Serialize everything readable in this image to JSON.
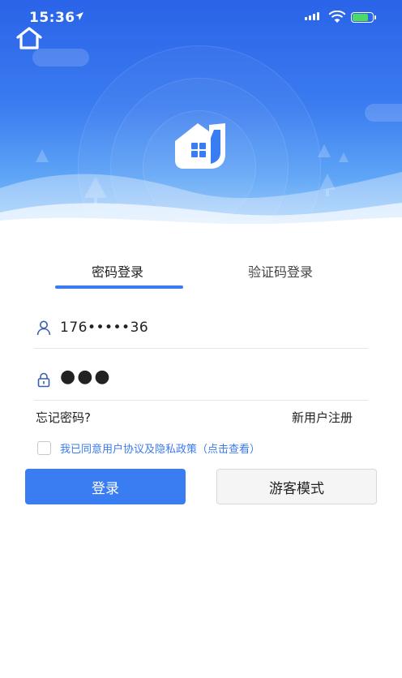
{
  "status_bar": {
    "time": "15:36"
  },
  "header": {
    "home_icon": "home-outline-icon",
    "logo_icon": "house-app-logo-icon"
  },
  "tabs": [
    {
      "label": "密码登录",
      "active": true
    },
    {
      "label": "验证码登录",
      "active": false
    }
  ],
  "form": {
    "phone": {
      "icon": "user-icon",
      "value": "176•••••36"
    },
    "password": {
      "icon": "lock-icon",
      "value": "●●●"
    }
  },
  "links": {
    "forgot": "忘记密码?",
    "register": "新用户注册"
  },
  "agreement": {
    "checked": false,
    "text": "我已同意用户协议及隐私政策（点击查看）"
  },
  "buttons": {
    "login": "登录",
    "guest": "游客模式"
  },
  "colors": {
    "primary": "#3a7df3",
    "header_top": "#2a63e8",
    "link": "#3a7bf0"
  }
}
